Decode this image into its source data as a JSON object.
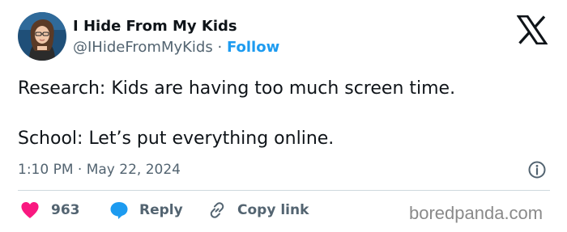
{
  "author": {
    "display_name": "I Hide From My Kids",
    "handle": "@IHideFromMyKids",
    "separator": "·",
    "follow_label": "Follow"
  },
  "tweet": {
    "line_1": "Research: Kids are having too much screen time.",
    "line_2": "School: Let’s put everything online."
  },
  "meta": {
    "timestamp": "1:10 PM · May 22, 2024"
  },
  "actions": {
    "like_count": "963",
    "reply_label": "Reply",
    "copy_link_label": "Copy link"
  },
  "watermark": "boredpanda.com",
  "icons": {
    "brand": "x-logo-icon",
    "info": "info-icon",
    "like": "heart-icon",
    "reply": "speech-bubble-icon",
    "copy": "link-icon"
  },
  "colors": {
    "accent": "#1d9bf0",
    "like": "#f91880",
    "text": "#0f1419",
    "secondary": "#536471",
    "divider": "#cfd9de",
    "watermark": "#8a8a8a"
  }
}
